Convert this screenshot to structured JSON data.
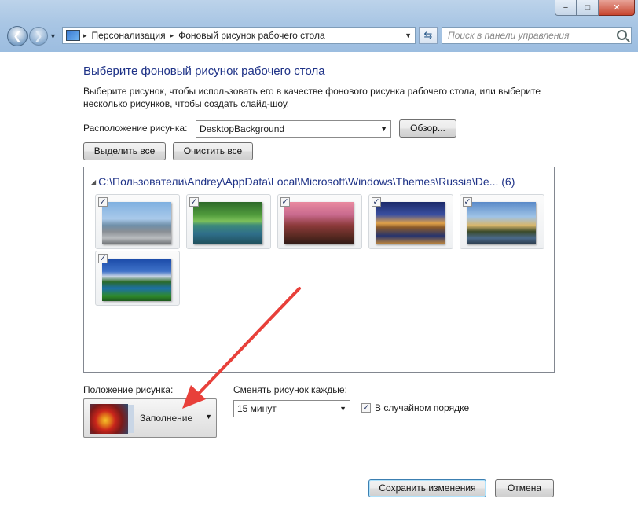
{
  "window": {
    "controls": {
      "minimize": "−",
      "maximize": "□",
      "close": "✕"
    }
  },
  "nav": {
    "back_glyph": "❮",
    "forward_glyph": "❯",
    "dropdown_glyph": "▼",
    "breadcrumbs": [
      "Персонализация",
      "Фоновый рисунок рабочего стола"
    ],
    "breadcrumb_separator": "▸",
    "refresh_glyph": "⇆",
    "search_placeholder": "Поиск в панели управления"
  },
  "main": {
    "heading": "Выберите фоновый рисунок рабочего стола",
    "description_line1": "Выберите рисунок, чтобы использовать его в качестве фонового рисунка рабочего стола, или выберите",
    "description_line2": "несколько рисунков, чтобы создать слайд-шоу.",
    "location_label": "Расположение рисунка:",
    "location_value": "DesktopBackground",
    "browse_button": "Обзор...",
    "select_all_button": "Выделить все",
    "clear_all_button": "Очистить все"
  },
  "gallery": {
    "folder_path": "C:\\Пользователи\\Andrey\\AppData\\Local\\Microsoft\\Windows\\Themes\\Russia\\De...",
    "count": "(6)",
    "check_glyph": "✓",
    "thumbnails": [
      {
        "name": "shore",
        "checked": true
      },
      {
        "name": "lake",
        "checked": true
      },
      {
        "name": "cathedral",
        "checked": true
      },
      {
        "name": "city",
        "checked": true
      },
      {
        "name": "sunset",
        "checked": true
      },
      {
        "name": "volcano",
        "checked": true
      }
    ]
  },
  "options": {
    "position_label": "Положение рисунка:",
    "position_value": "Заполнение",
    "interval_label": "Сменять рисунок каждые:",
    "interval_value": "15 минут",
    "shuffle_label": "В случайном порядке",
    "shuffle_checked": true
  },
  "footer": {
    "save_button": "Сохранить изменения",
    "cancel_button": "Отмена"
  },
  "colors": {
    "heading": "#1e3287",
    "annotation_arrow": "#e8403a"
  }
}
